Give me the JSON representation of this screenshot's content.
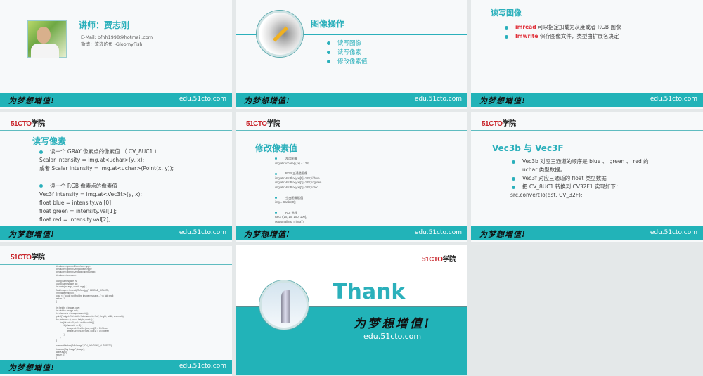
{
  "common": {
    "slogan": "为梦想增值!",
    "url": "edu.51cto.com",
    "logo_num": "51CTO",
    "logo_cn": "学院"
  },
  "slide1": {
    "title": "讲师：贾志刚",
    "email": "E-Mail: bfnh1998@hotmail.com",
    "weibo": "微博：流浪的鱼 -GloomyFish"
  },
  "slide2": {
    "title": "图像操作",
    "items": [
      "读写图像",
      "读写像素",
      "修改像素值"
    ]
  },
  "slide3": {
    "title": "读写图像",
    "items": [
      {
        "kw": "imread",
        "text": "可以指定加载为灰度或者 RGB 图像"
      },
      {
        "kw": "Imwrite",
        "text": "保存图像文件，类型由扩展名决定"
      }
    ],
    "kw_color": "#e0303a"
  },
  "slide4": {
    "title": "读写像素",
    "b1": "读一个 GRAY 像素点的像素值 （ CV_8UC1 ）",
    "l1": "Scalar intensity = img.at<uchar>(y, x);",
    "l2": "或者  Scalar intensity = img.at<uchar>(Point(x, y));",
    "b2": "读一个 RGB 像素点的像素值",
    "l3": "Vec3f intensity = img.at<Vec3f>(y, x);",
    "l4": "float blue = intensity.val[0];",
    "l5": "float green = intensity.val[1];",
    "l6": "float red = intensity.val[2];"
  },
  "slide5": {
    "title": "修改像素值",
    "h1": "灰度图像",
    "c1": "img.at<uchar>(y, x) = 128;",
    "h2": "RGB 三通道图像",
    "c2": "img.at<Vec3b>(y,x)[0]=128; // blue\nimg.at<Vec3b>(y,x)[1]=128; // green\nimg.at<Vec3b>(y,x)[2]=128; // red",
    "h3": "空白图像赋值",
    "c3": "img = Scalar(0);",
    "h4": "ROI 选择",
    "c4": "Rect r(10, 10, 100, 100);\nMat smallImg = img(r);"
  },
  "slide6": {
    "title": "Vec3b 与 Vec3F",
    "b1": "Vec3b 对应三通道的顺序是 blue 、 green 、 red 的",
    "b1b": "uchar 类型数据。",
    "b2": "Vec3f 对应三通道的 float 类型数据",
    "b3": "把 CV_8UC1 转换到 CV32F1 实现如下：",
    "code": "src.convertTo(dst, CV_32F);"
  },
  "slide7": {
    "code": "#include <opencv2/core/core.hpp>\n#include <opencv2/imgcodecs.hpp>\n#include <opencv2/highgui/highgui.hpp>\n#include <iostream>\n\nusing namespace cv;\nusing namespace std;\nint main(int argc, char** argv) {\nMat image = imread(\"D:/test.jpg\", IMREAD_COLOR);\nif (image.empty()) {\ncout << \"could not find the image resource...\" << std::endl;\nreturn -1;\n}\n\nint height = image.rows;\nint width = image.cols;\nint channels = image.channels();\nprintf(\"height=%d width=%d channels=%d\", height, width, channels);\nfor (int row = 0; row < height; row++) {\n      for (int col = 0; col < width; col++) {\n            if (channels == 3) {\n                  image.at<Vec3b>(row, col)[0] = 0; // blue\n                  image.at<Vec3b>(row, col)[1] = 0; // green\n            }\n      }\n}\n\nnamedWindow(\"My Image\", CV_WINDOW_AUTOSIZE);\nimshow(\"My Image\", image);\nwaitKey(0);\nreturn 0;\n}"
  },
  "slide8": {
    "title": "Thank"
  }
}
